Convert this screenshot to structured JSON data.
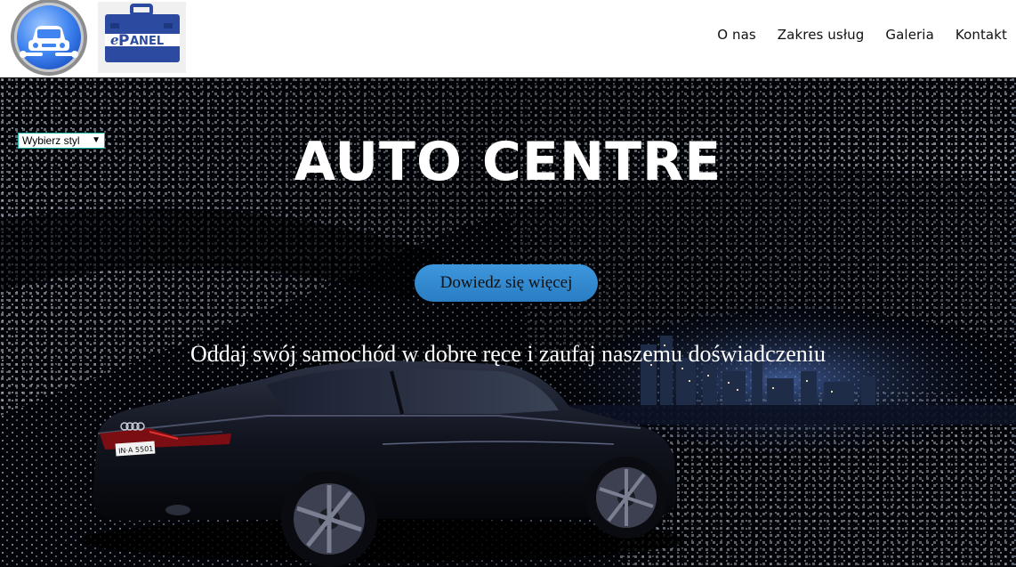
{
  "header": {
    "logo_car_icon": "car-wrench-icon",
    "logo_panel": {
      "icon": "toolbox-icon",
      "text_e": "e",
      "text_p": "P",
      "text_anel": "ANEL"
    },
    "nav": [
      {
        "label": "O nas"
      },
      {
        "label": "Zakres usług"
      },
      {
        "label": "Galeria"
      },
      {
        "label": "Kontakt"
      }
    ]
  },
  "hero": {
    "style_select": {
      "value": "Wybierz styl",
      "arrow": "▼"
    },
    "title": "AUTO CENTRE",
    "cta_label": "Dowiedz się więcej",
    "tagline": "Oddaj swój samochód w dobre ręce i zaufaj naszemu doświadczeniu",
    "car_plate": "IN·A 5501"
  },
  "colors": {
    "header_bg": "#ffffff",
    "hero_bg": "#000000",
    "cta_bg": "#3a92d8",
    "panel_blue": "#2b4aa0",
    "logo_blue": "#3f84f0"
  }
}
